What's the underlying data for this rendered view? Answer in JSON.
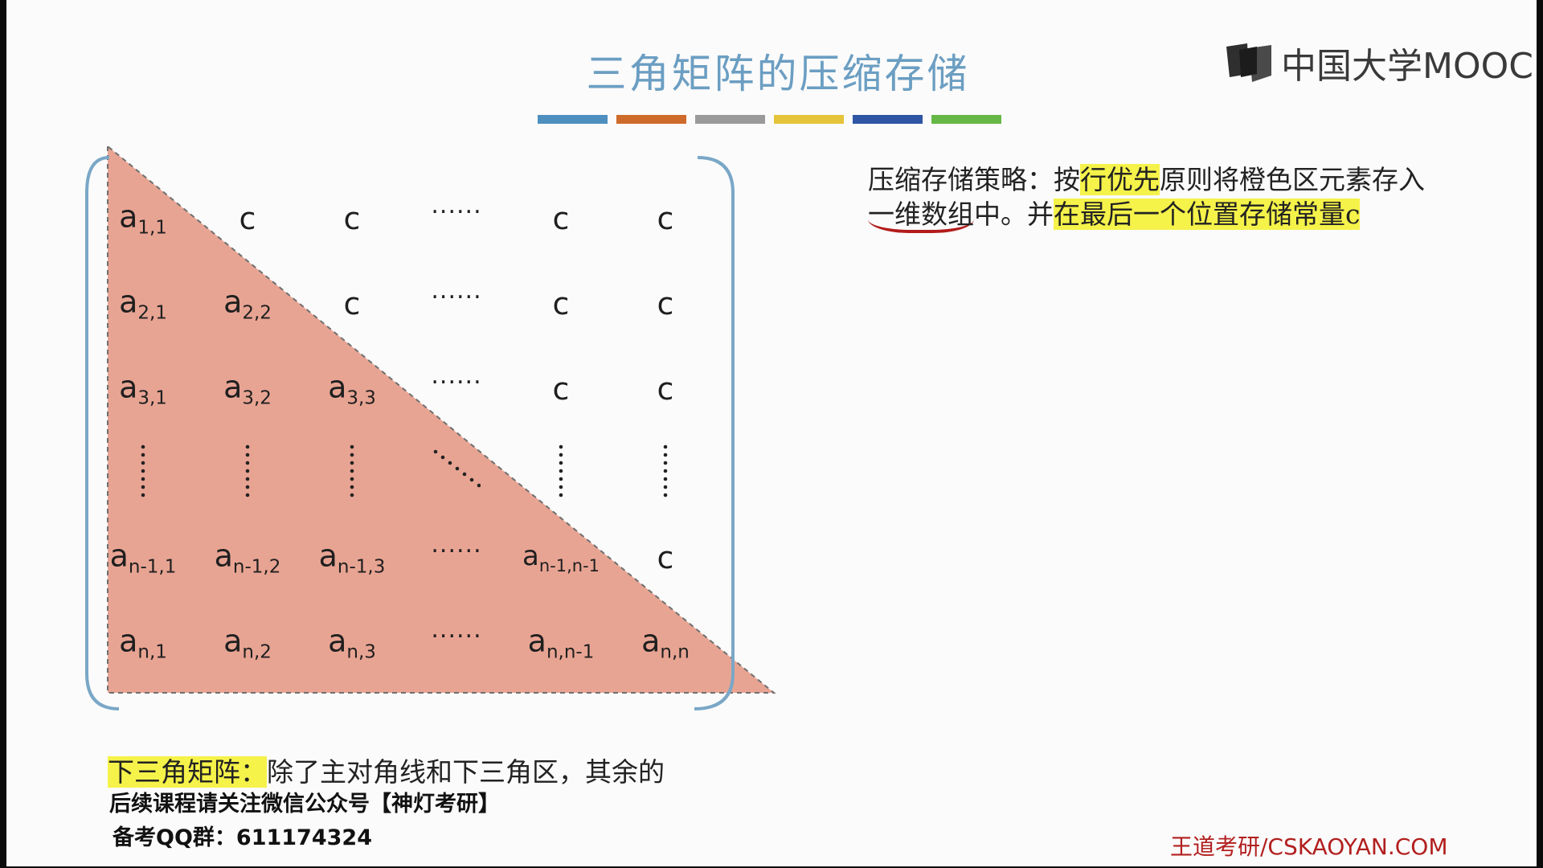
{
  "title": "三角矩阵的压缩存储",
  "logo": {
    "text": "中国大学MOOC",
    "icon": "book-icon"
  },
  "color_bar": [
    "#4e8fc0",
    "#cf6b2a",
    "#9a9a9a",
    "#e5c43a",
    "#2f56a4",
    "#65b845"
  ],
  "matrix": {
    "fill_color": "#e8a493",
    "rows": [
      [
        {
          "b": "a",
          "s": "1,1"
        },
        {
          "t": "c"
        },
        {
          "t": "c"
        },
        {
          "d": "h"
        },
        {
          "t": "c"
        },
        {
          "t": "c"
        }
      ],
      [
        {
          "b": "a",
          "s": "2,1"
        },
        {
          "b": "a",
          "s": "2,2"
        },
        {
          "t": "c"
        },
        {
          "d": "h"
        },
        {
          "t": "c"
        },
        {
          "t": "c"
        }
      ],
      [
        {
          "b": "a",
          "s": "3,1"
        },
        {
          "b": "a",
          "s": "3,2"
        },
        {
          "b": "a",
          "s": "3,3"
        },
        {
          "d": "h"
        },
        {
          "t": "c"
        },
        {
          "t": "c"
        }
      ],
      [
        {
          "d": "v"
        },
        {
          "d": "v"
        },
        {
          "d": "v"
        },
        {
          "d": "diag"
        },
        {
          "d": "v"
        },
        {
          "d": "v"
        }
      ],
      [
        {
          "b": "a",
          "s": "n-1,1"
        },
        {
          "b": "a",
          "s": "n-1,2"
        },
        {
          "b": "a",
          "s": "n-1,3"
        },
        {
          "d": "h"
        },
        {
          "b": "a",
          "s": "n-1,n-1",
          "small": true
        },
        {
          "t": "c"
        }
      ],
      [
        {
          "b": "a",
          "s": "n,1"
        },
        {
          "b": "a",
          "s": "n,2"
        },
        {
          "b": "a",
          "s": "n,3"
        },
        {
          "d": "h"
        },
        {
          "b": "a",
          "s": "n,n-1"
        },
        {
          "b": "a",
          "s": "n,n"
        }
      ]
    ]
  },
  "strategy": {
    "p1": "压缩存储策略：按",
    "p2": "行优先",
    "p3": "原则将橙色区元素存入",
    "p4": "一维数组",
    "p5": "中。并",
    "p6": "在最后一个位置存储常量c"
  },
  "definition": {
    "label": "下三角矩阵：",
    "text": "除了主对角线和下三角区，其余的"
  },
  "notice": "后续课程请关注微信公众号【神灯考研】",
  "qq": "备考QQ群：611174324",
  "site": "王道考研/CSKAOYAN.COM"
}
